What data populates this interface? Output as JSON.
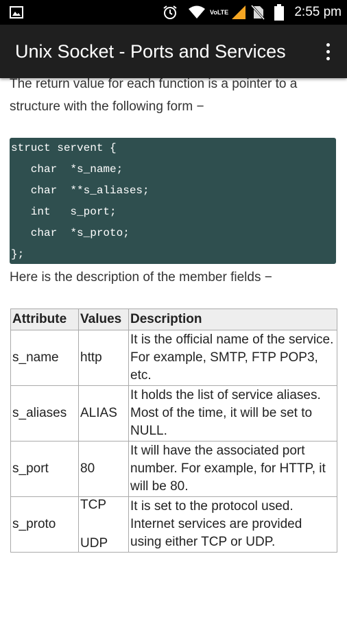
{
  "status_bar": {
    "time": "2:55 pm",
    "network_label": "VoLTE",
    "icons": [
      "image-icon",
      "alarm-icon",
      "wifi-icon",
      "signal-icon",
      "no-sim-icon",
      "battery-icon"
    ]
  },
  "app_bar": {
    "title": "Unix Socket - Ports and Services",
    "menu_icon": "overflow-menu-icon"
  },
  "content": {
    "intro": "The return value for each function is a pointer to a structure with the following form −",
    "code_lines": [
      "struct servent {",
      "   char  *s_name;",
      "   char  **s_aliases;",
      "   int   s_port;",
      "   char  *s_proto;",
      "};"
    ],
    "members_intro": "Here is the description of the member fields −",
    "table": {
      "headers": [
        "Attribute",
        "Values",
        "Description"
      ],
      "rows": [
        {
          "attribute": "s_name",
          "values": "http",
          "description": "It is the official name of the service. For example, SMTP, FTP POP3, etc."
        },
        {
          "attribute": "s_aliases",
          "values": "ALIAS",
          "description": "It holds the list of service aliases. Most of the time, it will be set to NULL."
        },
        {
          "attribute": "s_port",
          "values": "80",
          "description": "It will have the associated port number. For example, for HTTP, it will be 80."
        },
        {
          "attribute": "s_proto",
          "values": [
            "TCP",
            "UDP"
          ],
          "description": "It is set to the protocol used. Internet services are provided using either TCP or UDP."
        }
      ]
    }
  },
  "colors": {
    "status_bar_bg": "#000000",
    "app_bar_bg": "#1f1f1f",
    "code_bg": "#2f4f4f",
    "signal_accent": "#f5a623"
  }
}
